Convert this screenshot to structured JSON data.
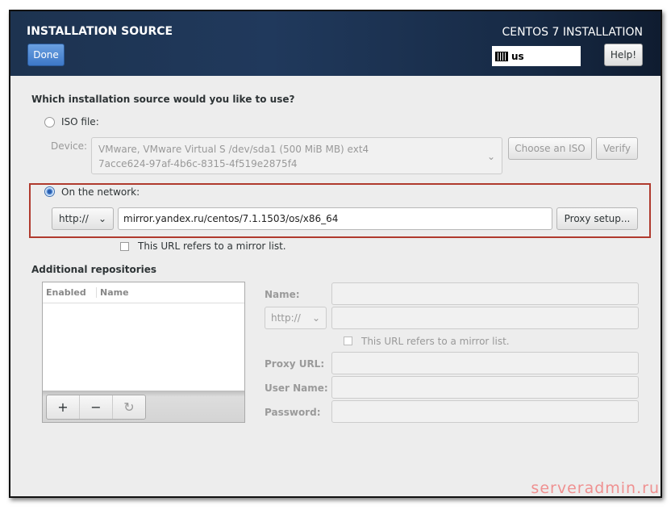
{
  "header": {
    "title": "INSTALLATION SOURCE",
    "done_label": "Done",
    "product": "CENTOS 7 INSTALLATION",
    "keyboard_layout": "us",
    "help_label": "Help!"
  },
  "source": {
    "question": "Which installation source would you like to use?",
    "iso_label": "ISO file:",
    "device_label": "Device:",
    "device_line1": "VMware, VMware Virtual S /dev/sda1 (500 MiB MB) ext4",
    "device_line2": "7acce624-97af-4b6c-8315-4f519e2875f4",
    "choose_iso_label": "Choose an ISO",
    "verify_label": "Verify",
    "network_label": "On the network:",
    "protocol": "http://",
    "url": "mirror.yandex.ru/centos/7.1.1503/os/x86_64",
    "proxy_label": "Proxy setup...",
    "mirror_label": "This URL refers to a mirror list."
  },
  "repos": {
    "title": "Additional repositories",
    "columns": [
      "Enabled",
      "Name"
    ],
    "name_label": "Name:",
    "protocol": "http://",
    "mirror_label": "This URL refers to a mirror list.",
    "proxy_url_label": "Proxy URL:",
    "user_label": "User Name:",
    "password_label": "Password:",
    "add": "+",
    "remove": "−",
    "refresh": "↻"
  },
  "watermark": "serveradmin.ru",
  "colors": {
    "highlight": "#c0392b",
    "accent": "#3d78c8"
  }
}
